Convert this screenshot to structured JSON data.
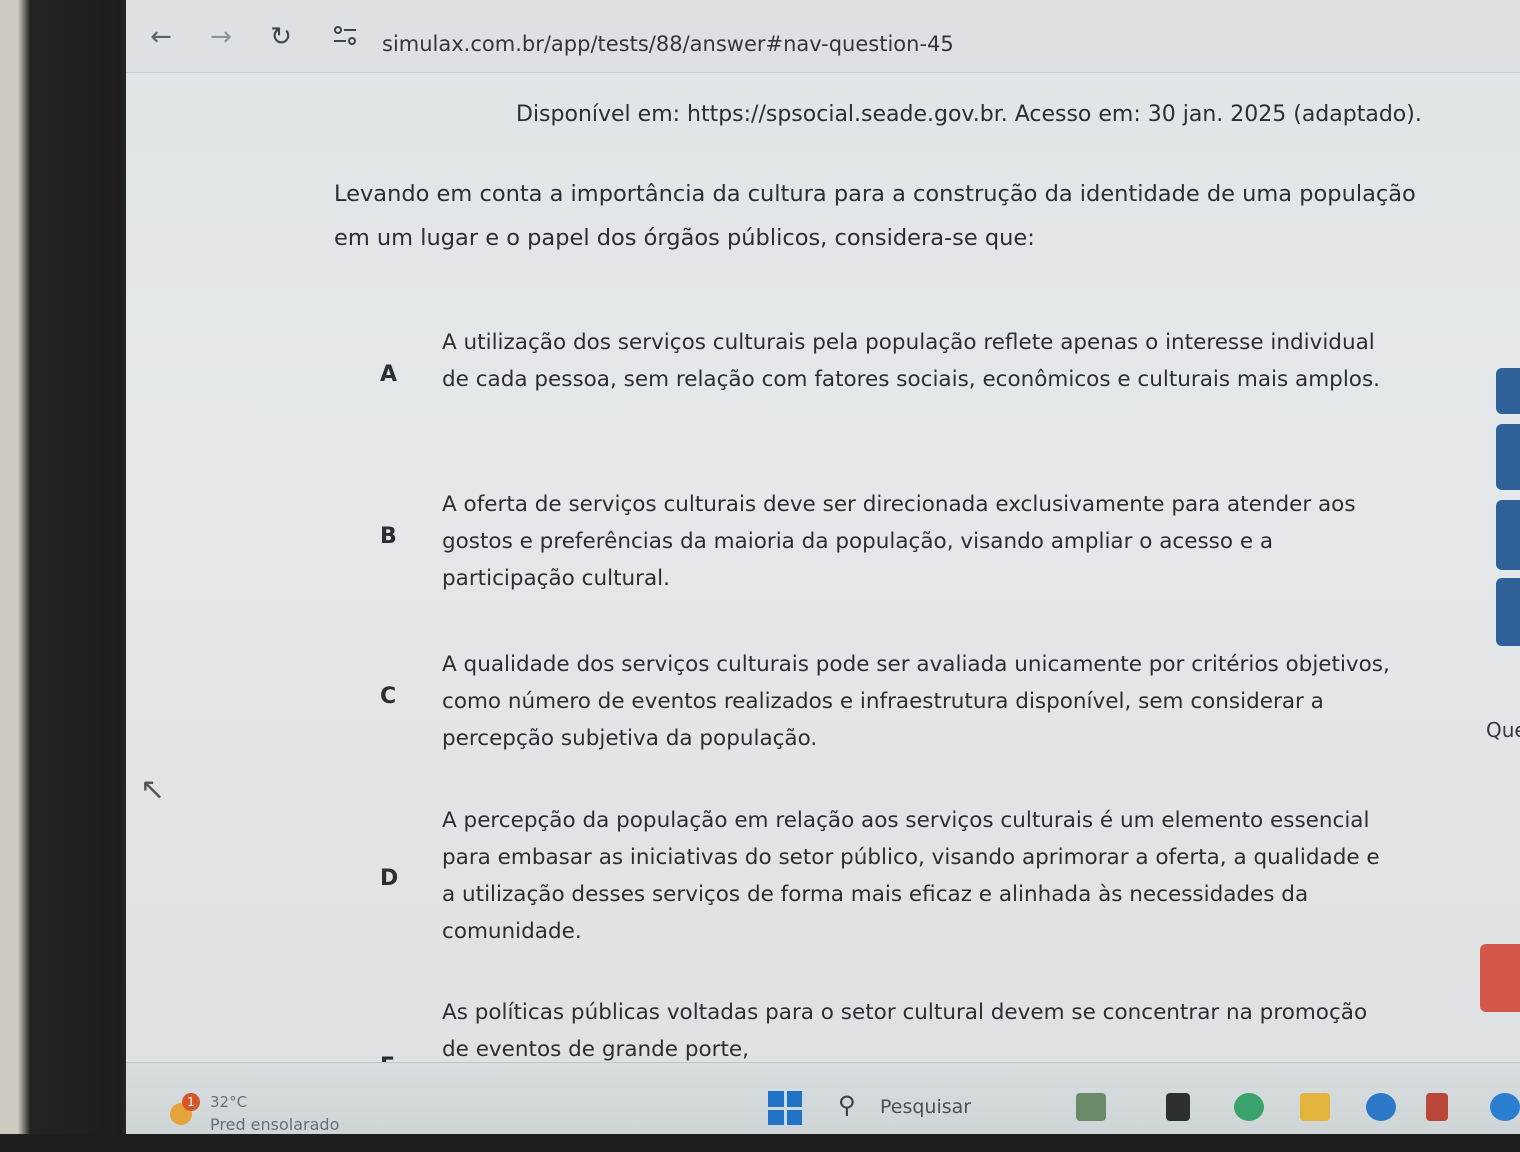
{
  "browser": {
    "url": "simulax.com.br/app/tests/88/answer#nav-question-45",
    "back_icon": "arrow-left-icon",
    "forward_icon": "arrow-right-icon",
    "reload_icon": "reload-icon",
    "site_info_icon": "site-settings-icon"
  },
  "question": {
    "source": "Disponível em: https://spsocial.seade.gov.br. Acesso em: 30 jan. 2025 (adaptado).",
    "prompt": "Levando em conta a importância da cultura para a construção da identidade de uma população em um lugar e o papel dos órgãos públicos, considera-se que:",
    "options": [
      {
        "letter": "A",
        "text": "A utilização dos serviços culturais pela população reflete apenas o interesse individual de cada pessoa, sem relação com fatores sociais, econômicos e culturais mais amplos."
      },
      {
        "letter": "B",
        "text": "A oferta de serviços culturais deve ser direcionada exclusivamente para atender aos gostos e preferências da maioria da população, visando ampliar o acesso e a participação cultural."
      },
      {
        "letter": "C",
        "text": "A qualidade dos serviços culturais pode ser avaliada unicamente por critérios objetivos, como número de eventos realizados e infraestrutura disponível, sem considerar a percepção subjetiva da população."
      },
      {
        "letter": "D",
        "text": "A percepção da população em relação aos serviços culturais é um elemento essencial para embasar as iniciativas do setor público, visando aprimorar a oferta, a qualidade e a utilização desses serviços de forma mais eficaz e alinhada às necessidades da comunidade."
      },
      {
        "letter": "E",
        "text": "As políticas públicas voltadas para o setor cultural devem se concentrar na promoção de eventos de grande porte,"
      }
    ]
  },
  "side_nav": {
    "label": "Que"
  },
  "taskbar": {
    "weather_badge": "1",
    "temperature": "32°C",
    "weather": "Pred ensolarado",
    "search_placeholder": "Pesquisar",
    "colors": {
      "accent": "#2f6198",
      "alert": "#d2574a",
      "windows": "#1f74c8"
    }
  }
}
